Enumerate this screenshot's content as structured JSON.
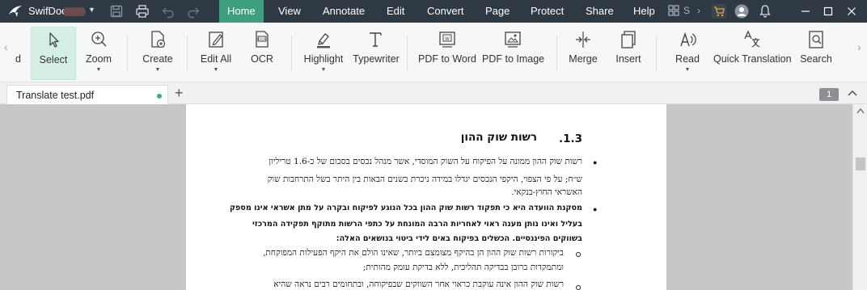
{
  "titlebar": {
    "app_name": "SwifDoo",
    "menu": [
      "Home",
      "View",
      "Annotate",
      "Edit",
      "Convert",
      "Page",
      "Protect",
      "Share",
      "Help"
    ],
    "active_menu": "Home",
    "search_hint": "S"
  },
  "ribbon": {
    "partial_left": "d",
    "tools": [
      {
        "label": "Select",
        "icon": "cursor-icon"
      },
      {
        "label": "Zoom",
        "icon": "zoom-icon"
      },
      {
        "label": "Create",
        "icon": "create-doc-icon"
      },
      {
        "label": "Edit All",
        "icon": "edit-icon"
      },
      {
        "label": "OCR",
        "icon": "ocr-icon"
      },
      {
        "label": "Highlight",
        "icon": "highlight-icon"
      },
      {
        "label": "Typewriter",
        "icon": "typewriter-icon"
      },
      {
        "label": "PDF to Word",
        "icon": "pdf-to-word-icon"
      },
      {
        "label": "PDF to Image",
        "icon": "pdf-to-image-icon"
      },
      {
        "label": "Merge",
        "icon": "merge-icon"
      },
      {
        "label": "Insert",
        "icon": "insert-icon"
      },
      {
        "label": "Read",
        "icon": "read-aloud-icon"
      },
      {
        "label": "Quick Translation",
        "icon": "translate-icon"
      },
      {
        "label": "Search",
        "icon": "search-doc-icon"
      }
    ]
  },
  "tabs": {
    "document": "Translate test.pdf",
    "add": "+",
    "page_number": "1"
  },
  "document": {
    "heading_number": "1.3.",
    "heading_text": "רשות שוק ההון",
    "b1_l1": "רשות שוק ההון ממונה על הפיקוח על השוק המוסדי, אשר מנהל נכסים בסכום של כ-1.6 טריליון",
    "b1_l2": "ש״ח; על פי הצפוי, היקפי הנכסים יגדלו במידה ניכרת בשנים הבאות בין היתר בשל התרחבות שוק",
    "b1_l3": "האשראי החוץ-בנקאי.",
    "b2_l1": "מסקנת הוועדה היא כי תפקוד רשות שוק ההון בכל הנוגע לפיקוח ובקרה על מתן אשראי אינו מספק",
    "b2_l2": "בעליל ואינו נותן מענה ראוי לאחריות הרבה המונחת על כתפי הרשות מתוקף תפקידה המרכזי",
    "b2_l3": "בשווקים הפיננסיים. הכשלים בפיקוח באים לידי ביטוי בנושאים האלה:",
    "s1_l1": "ביקורות רשות שוק ההון הן בהיקף מצומצם ביותר, שאינו הולם את היקף הפעילות המפוקחת,",
    "s1_l2": "ומתמקדות ברובן בבדיקה תהליכית, ללא בדיקת עומק מהותית;",
    "s2_l1": "רשות שוק ההון אינה עוקבת כראוי אחר השווקים שבפיקוחה, ובתחומים רבים נראה שהיא"
  }
}
